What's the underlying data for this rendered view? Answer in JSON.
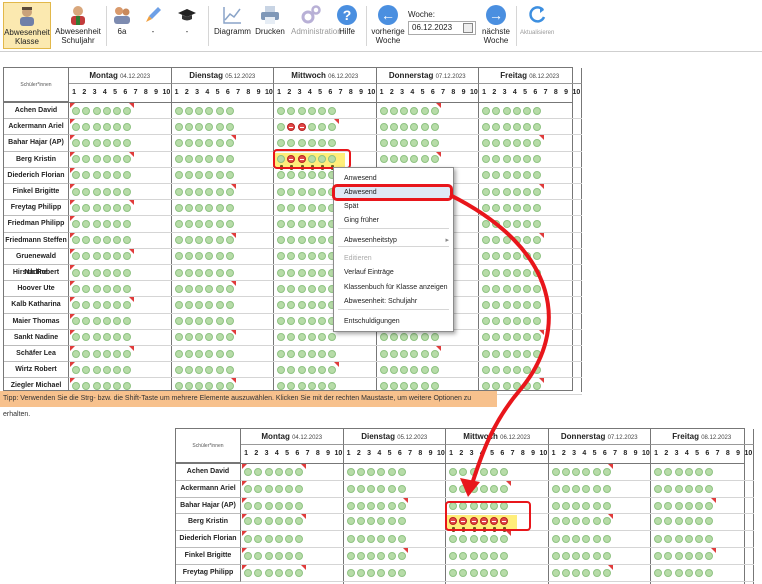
{
  "toolbar": {
    "buttons": [
      {
        "label": "Abwesenheit Klasse",
        "icon": "user-class-icon",
        "active": true
      },
      {
        "label": "Abwesenheit Schuljahr",
        "icon": "user-year-icon",
        "active": false
      },
      {
        "label": "6a",
        "icon": "group-icon",
        "active": false
      },
      {
        "label": "-",
        "icon": "rocket-icon",
        "active": false
      },
      {
        "label": "-",
        "icon": "graduation-cap-icon",
        "active": false
      },
      {
        "label": "Diagramm",
        "icon": "chart-icon",
        "active": false
      },
      {
        "label": "Drucken",
        "icon": "printer-icon",
        "active": false
      },
      {
        "label": "Administration",
        "icon": "gears-icon",
        "active": false
      },
      {
        "label": "Hilfe",
        "icon": "help-icon",
        "active": false
      },
      {
        "label": "vorherige Woche",
        "icon": "arrow-left-icon",
        "active": false
      },
      {
        "label": "nächste Woche",
        "icon": "arrow-right-icon",
        "active": false
      },
      {
        "label": "Aktualisieren",
        "icon": "refresh-icon",
        "active": false
      }
    ],
    "week_label": "Woche:",
    "week_value": "06.12.2023"
  },
  "grid_header": {
    "corner_label": "Schüler*innen",
    "days": [
      {
        "name": "Montag",
        "date": "04.12.2023"
      },
      {
        "name": "Dienstag",
        "date": "05.12.2023"
      },
      {
        "name": "Mittwoch",
        "date": "06.12.2023"
      },
      {
        "name": "Donnerstag",
        "date": "07.12.2023"
      },
      {
        "name": "Freitag",
        "date": "08.12.2023"
      }
    ],
    "periods": [
      "1",
      "2",
      "3",
      "4",
      "5",
      "6",
      "7",
      "8",
      "9",
      "10"
    ]
  },
  "students": [
    "Achen David",
    "Ackermann Ariel",
    "Bahar Hajar (AP)",
    "Berg Kristin",
    "Diederich Florian",
    "Finkel Brigitte",
    "Freytag Philipp",
    "Friedman Philipp",
    "Friedmann Steffen",
    "Gruenewald Nadine",
    "Hirsch Robert",
    "Hoover Ute",
    "Kalb Katharina",
    "Maier Thomas",
    "Sankt Nadine",
    "Schäfer Lea",
    "Wirtz Robert",
    "Ziegler Michael"
  ],
  "tip": "Tipp: Verwenden Sie die Strg- bzw. die Shift-Taste um mehrere Elemente auszuwählen. Klicken Sie mit der rechten Maustaste, um weitere Optionen zu erhalten.",
  "context_menu": {
    "items": [
      {
        "label": "Anwesend",
        "state": "normal"
      },
      {
        "label": "Abwesend",
        "state": "selected"
      },
      {
        "label": "Spät",
        "state": "normal"
      },
      {
        "label": "Ging früher",
        "state": "normal"
      },
      {
        "label": "Abwesenheitstyp",
        "state": "submenu"
      },
      {
        "label": "Editieren",
        "state": "disabled"
      },
      {
        "label": "Verlauf Einträge",
        "state": "normal"
      },
      {
        "label": "Klassenbuch für Klasse anzeigen",
        "state": "normal"
      },
      {
        "label": "Abwesenheit: Schuljahr",
        "state": "normal"
      },
      {
        "label": "Entschuldigungen",
        "state": "normal"
      }
    ]
  },
  "colors": {
    "present_dot": "#b7dca8",
    "absent_dot": "#e34848",
    "highlight": "#ffee7a",
    "annotation_red": "#e8161b",
    "tip_bg": "#f7c18d"
  }
}
